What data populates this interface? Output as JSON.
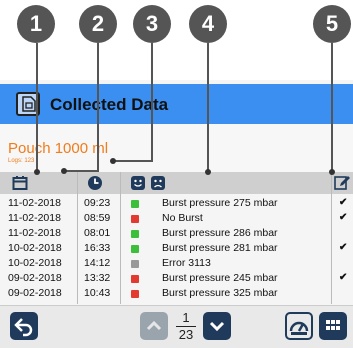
{
  "callouts": [
    "1",
    "2",
    "3",
    "4",
    "5"
  ],
  "title": {
    "text": "Collected Data",
    "icon": "document-icon"
  },
  "product": {
    "name": "Pouch 1000 ml",
    "logs": "Logs: 123"
  },
  "header_icons": [
    "calendar-icon",
    "clock-icon",
    "smiley-happy-icon",
    "smiley-sad-icon",
    "edit-icon"
  ],
  "rows": [
    {
      "date": "11-02-2018",
      "time": "09:23",
      "status": "green",
      "event": "Burst pressure 275 mbar",
      "check": "✔"
    },
    {
      "date": "11-02-2018",
      "time": "08:59",
      "status": "red",
      "event": "No Burst",
      "check": "✔"
    },
    {
      "date": "11-02-2018",
      "time": "08:01",
      "status": "green",
      "event": "Burst pressure 286 mbar",
      "check": ""
    },
    {
      "date": "10-02-2018",
      "time": "16:33",
      "status": "green",
      "event": "Burst pressure 281 mbar",
      "check": "✔"
    },
    {
      "date": "10-02-2018",
      "time": "14:12",
      "status": "gray",
      "event": "Error 3113",
      "check": ""
    },
    {
      "date": "09-02-2018",
      "time": "13:32",
      "status": "red",
      "event": "Burst pressure 245 mbar",
      "check": "✔"
    },
    {
      "date": "09-02-2018",
      "time": "10:43",
      "status": "red",
      "event": "Burst pressure 325 mbar",
      "check": ""
    }
  ],
  "pagination": {
    "current": "1",
    "total": "23"
  },
  "colors": {
    "accent": "#3a8ff0",
    "product": "#f07c1c",
    "green": "#3cc03c",
    "red": "#e23a2f",
    "gray": "#999999",
    "button": "#1f3a5a"
  }
}
